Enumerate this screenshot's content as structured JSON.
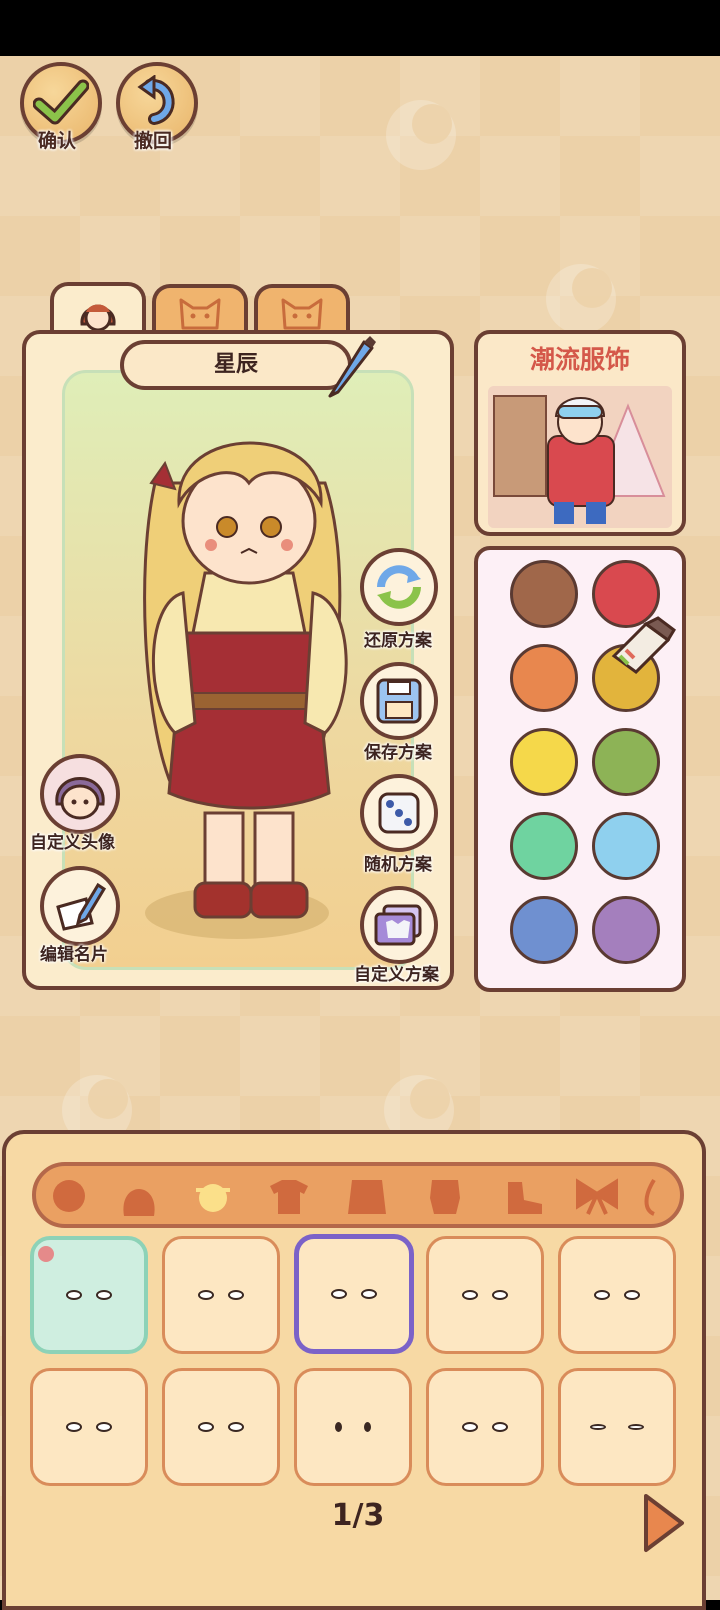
{
  "top_buttons": {
    "confirm_label": "确认",
    "undo_label": "撤回"
  },
  "tabs": [
    {
      "icon": "girl-face-icon",
      "active": true
    },
    {
      "icon": "cat-face-icon",
      "active": false
    },
    {
      "icon": "cat-face-icon",
      "active": false
    }
  ],
  "character": {
    "name": "星辰"
  },
  "side_actions": {
    "restore_label": "还原方案",
    "save_label": "保存方案",
    "random_label": "随机方案",
    "custom_plan_label": "自定义方案",
    "custom_avatar_label": "自定义头像",
    "edit_card_label": "编辑名片"
  },
  "trend": {
    "title": "潮流服饰"
  },
  "colors": [
    "#a0674a",
    "#d9494f",
    "#e8874e",
    "#e2b43c",
    "#f5d84a",
    "#8db356",
    "#6fd3a0",
    "#8fd0ee",
    "#6f90d0",
    "#a47fbd"
  ],
  "accent": "#6b3f33",
  "categories": [
    "face",
    "hair",
    "eyes",
    "top",
    "jacket",
    "outfit",
    "shoes",
    "bow",
    "accessory"
  ],
  "pager": {
    "text": "1/3"
  }
}
